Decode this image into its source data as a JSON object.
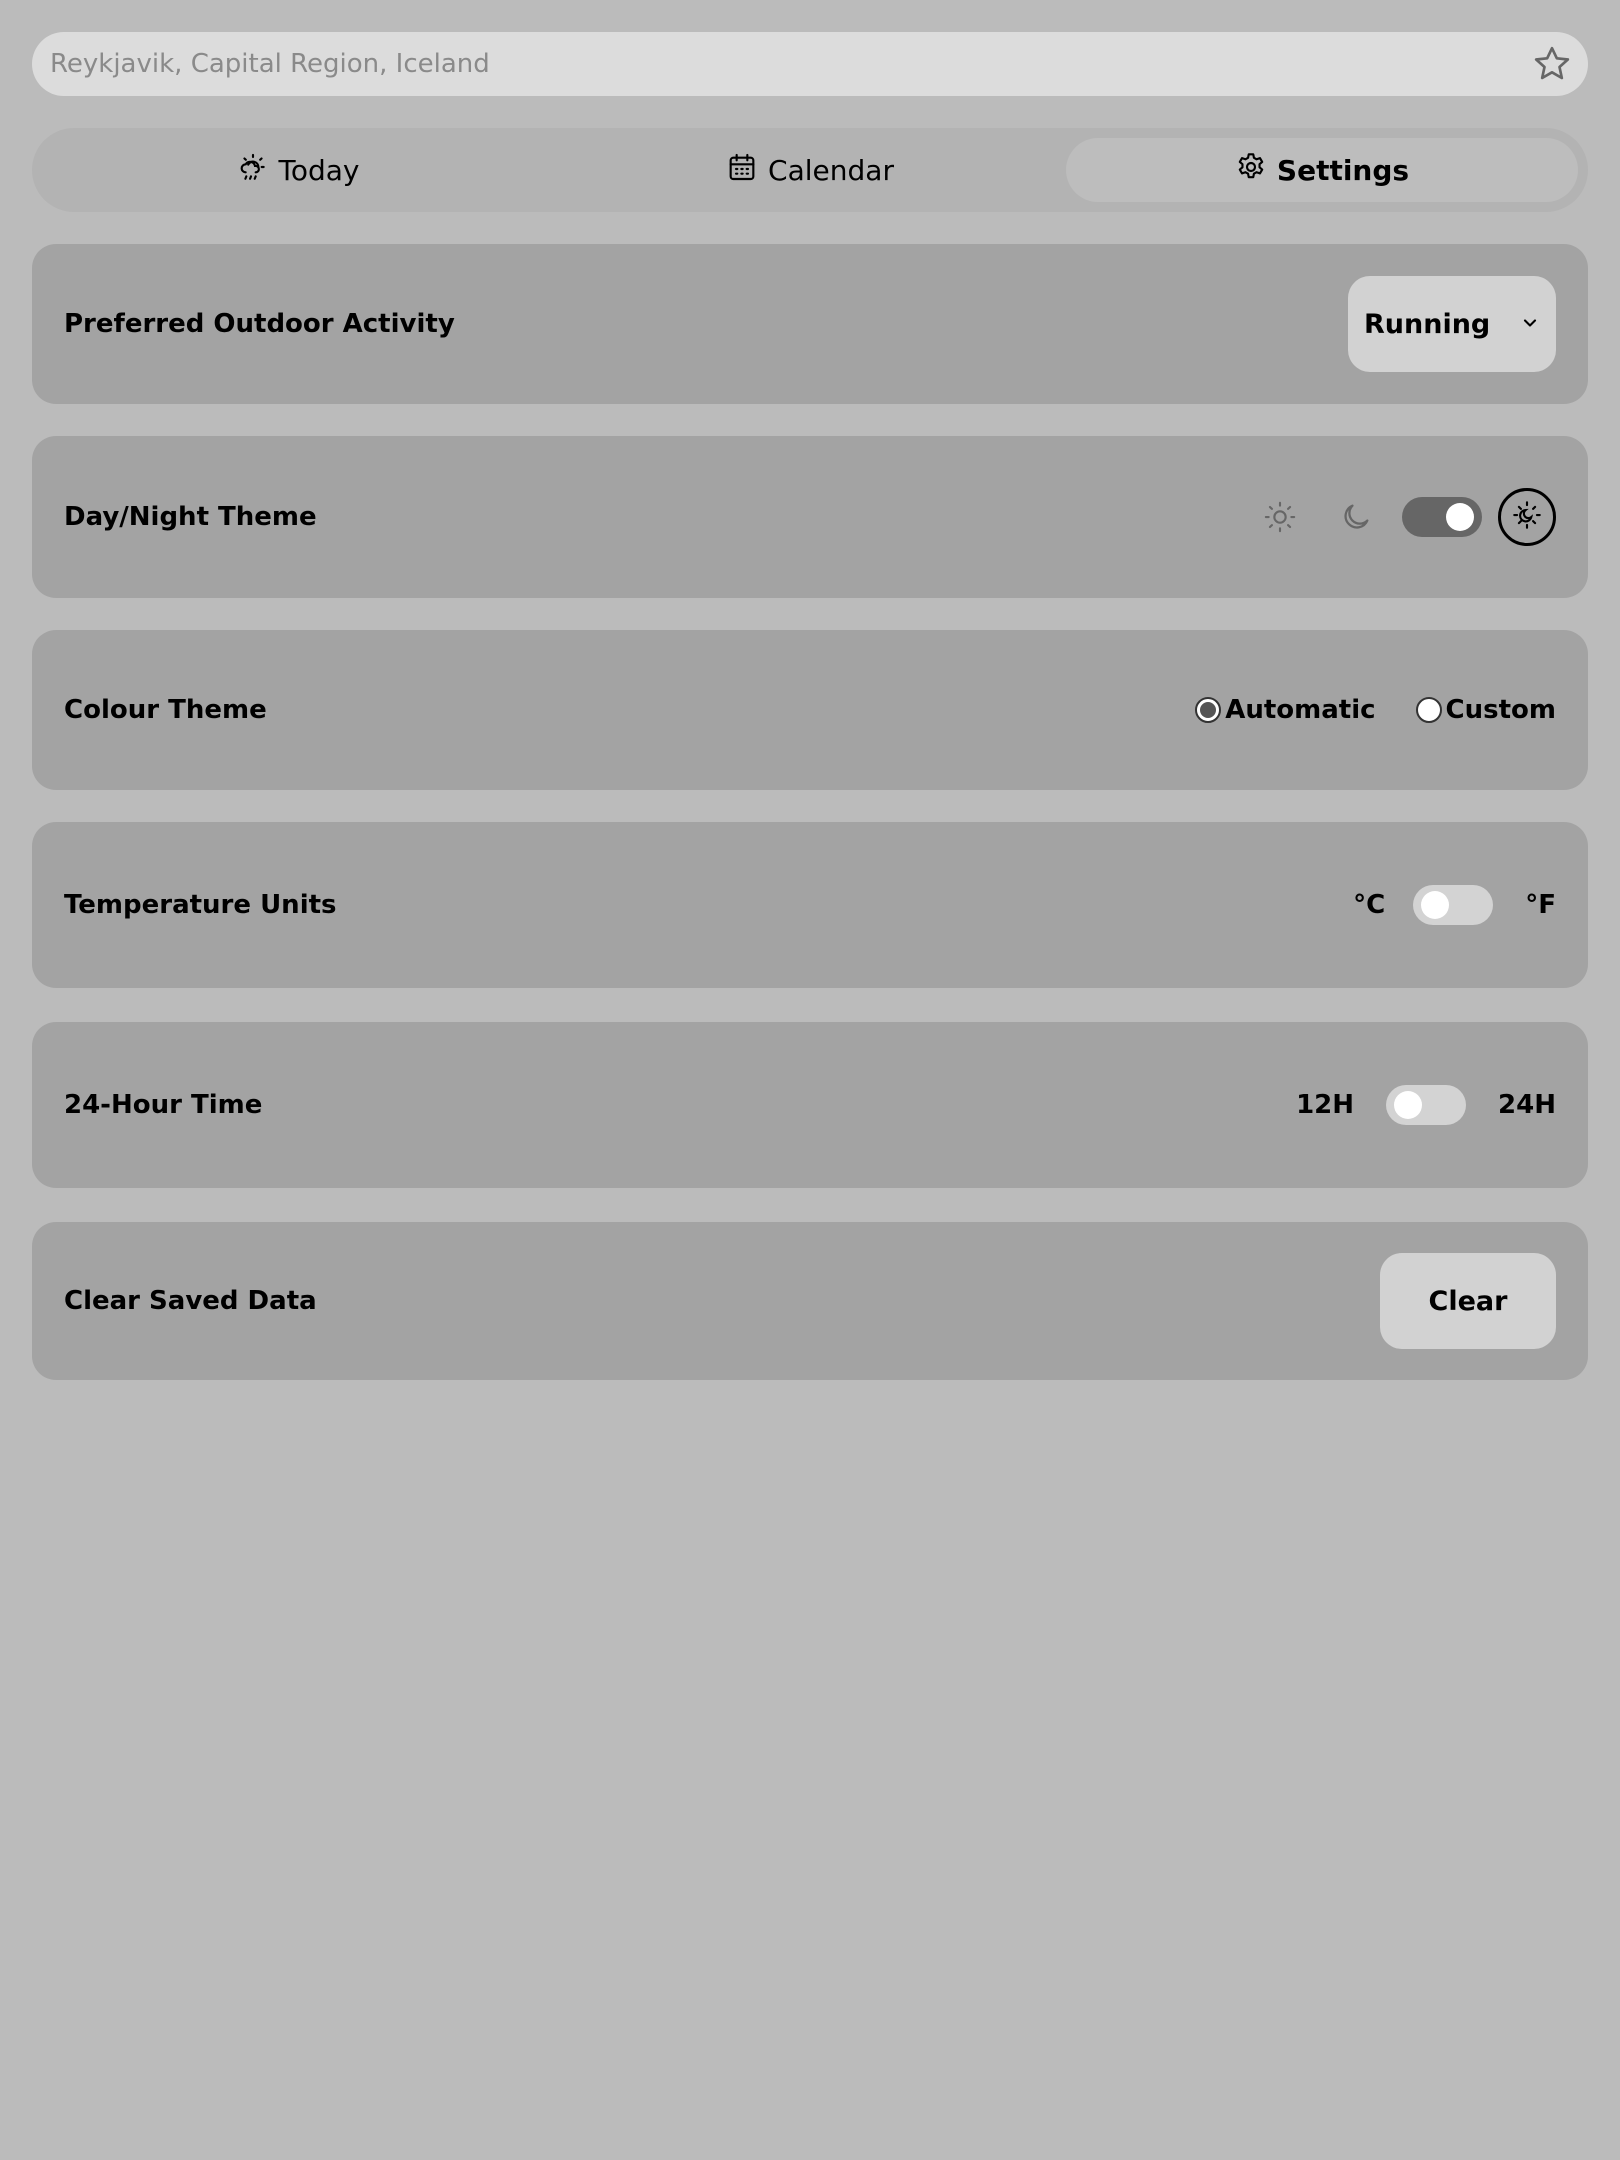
{
  "search": {
    "placeholder": "Reykjavik, Capital Region, Iceland",
    "favorite_icon": "star-icon"
  },
  "tabs": [
    {
      "label": "Today",
      "icon": "cloud-sun-rain-icon",
      "active": false
    },
    {
      "label": "Calendar",
      "icon": "calendar-icon",
      "active": false
    },
    {
      "label": "Settings",
      "icon": "gear-icon",
      "active": true
    }
  ],
  "settings": {
    "activity": {
      "label": "Preferred Outdoor Activity",
      "value": "Running"
    },
    "theme": {
      "label": "Day/Night Theme",
      "mode": "night",
      "auto_icon": "sun-moon-icon"
    },
    "colour": {
      "label": "Colour Theme",
      "options": [
        "Automatic",
        "Custom"
      ],
      "selected": "Automatic"
    },
    "temperature": {
      "label": "Temperature Units",
      "left": "°C",
      "right": "°F",
      "selected": "°C"
    },
    "time": {
      "label": "24-Hour Time",
      "left": "12H",
      "right": "24H",
      "selected": "12H"
    },
    "clear": {
      "label": "Clear Saved Data",
      "button": "Clear"
    }
  },
  "colors": {
    "background": "#bbbbbb",
    "card": "#a3a3a3",
    "control": "#d2d2d2",
    "toggle_on": "#666666"
  }
}
